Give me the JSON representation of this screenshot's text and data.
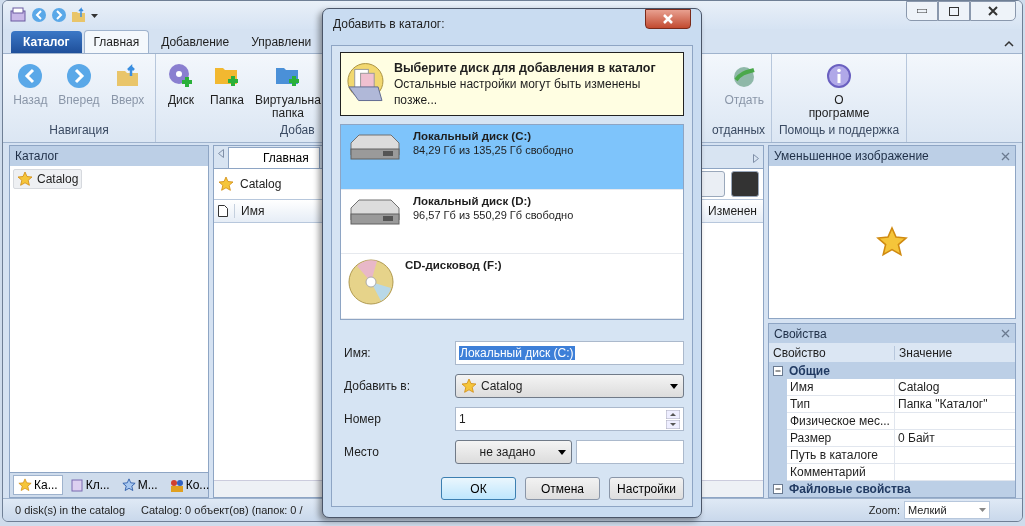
{
  "ribbon": {
    "app_button": "Каталог",
    "tabs": [
      {
        "label": "Главная",
        "selected": true
      },
      {
        "label": "Добавление",
        "selected": false
      },
      {
        "label": "Управлени",
        "selected": false
      }
    ],
    "groups": [
      {
        "label": "Навигация",
        "buttons": [
          {
            "label": "Назад",
            "disabled": true
          },
          {
            "label": "Вперед",
            "disabled": true
          },
          {
            "label": "Вверх",
            "disabled": true
          }
        ]
      },
      {
        "label": "Добав",
        "buttons": [
          {
            "label": "Диск",
            "disabled": false
          },
          {
            "label": "Папка",
            "disabled": false
          },
          {
            "label": "Виртуальна\nпапка",
            "disabled": false
          }
        ]
      },
      {
        "label": "отданных",
        "buttons": [
          {
            "label": "Отдать",
            "disabled": true
          }
        ]
      },
      {
        "label": "Помощь и поддержка",
        "buttons": [
          {
            "label": "О\nпрограмме",
            "disabled": false
          }
        ]
      }
    ]
  },
  "catalog_panel": {
    "title": "Каталог",
    "tree": [
      {
        "label": "Catalog",
        "selected": true
      }
    ],
    "tabs": [
      {
        "label": "Ка...",
        "selected": true
      },
      {
        "label": "Кл...",
        "selected": false
      },
      {
        "label": "М...",
        "selected": false
      },
      {
        "label": "Ко...",
        "selected": false
      }
    ]
  },
  "browser": {
    "tabs": [
      {
        "label": "Главная",
        "selected": true
      }
    ],
    "breadcrumb": "Catalog",
    "columns": [
      "Имя",
      "Изменен"
    ]
  },
  "thumbnail_panel": {
    "title": "Уменьшенное изображение"
  },
  "properties": {
    "title": "Свойства",
    "columns": [
      "Свойство",
      "Значение"
    ],
    "groups": [
      {
        "label": "Общие",
        "expanded": true,
        "rows": [
          {
            "name": "Имя",
            "value": "Catalog"
          },
          {
            "name": "Тип",
            "value": "Папка \"Каталог\""
          },
          {
            "name": "Физическое мес..."
          },
          {
            "name": "Размер",
            "value": "0 Байт"
          },
          {
            "name": "Путь в каталоге"
          },
          {
            "name": "Комментарий"
          }
        ]
      },
      {
        "label": "Файловые свойства",
        "expanded": true
      }
    ]
  },
  "status_bar": {
    "items": [
      "0 disk(s) in the catalog",
      "Catalog: 0 объект(ов) (папок: 0 /"
    ],
    "zoom_label": "Zoom:",
    "zoom_value": "Мелкий"
  },
  "dialog": {
    "title": "Добавить в каталог:",
    "heading": "Выберите диск для добавления в каталог",
    "subtext": "Остальные настройки могут быть изменены позже...",
    "drives": [
      {
        "kind": "hdd",
        "name": "Локальный диск (C:)",
        "info": "84,29 Гб из 135,25 Гб свободно",
        "selected": true
      },
      {
        "kind": "hdd",
        "name": "Локальный диск (D:)",
        "info": "96,57 Гб из 550,29 Гб свободно",
        "selected": false
      },
      {
        "kind": "cd",
        "name": "CD-дисковод (F:)",
        "selected": false
      }
    ],
    "fields": [
      {
        "kind": "text",
        "label": "Имя:",
        "value": "Локальный диск (C:)",
        "highlighted": true
      },
      {
        "kind": "combo",
        "label": "Добавить в:",
        "value": "Catalog"
      },
      {
        "kind": "spin",
        "label": "Номер",
        "value": "1"
      },
      {
        "kind": "combo_text",
        "label": "Место",
        "value": "не задано"
      }
    ],
    "buttons": [
      {
        "label": "ОК",
        "default": true
      },
      {
        "label": "Отмена",
        "default": false
      },
      {
        "label": "Настройки",
        "default": false
      }
    ]
  }
}
